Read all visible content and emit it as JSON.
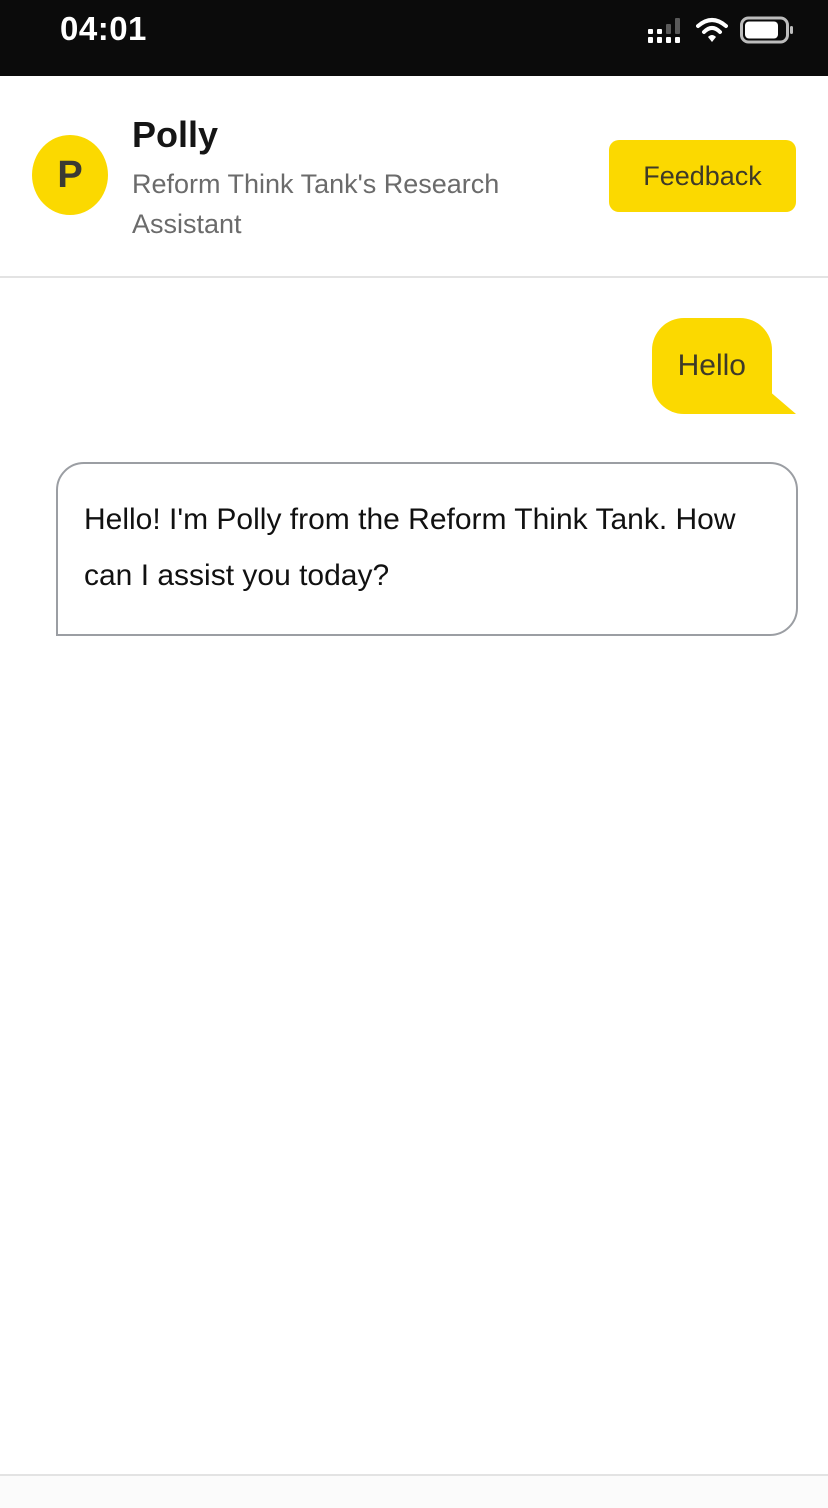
{
  "status_bar": {
    "time": "04:01",
    "icons": [
      "signal-icon",
      "wifi-icon",
      "battery-icon"
    ]
  },
  "header": {
    "avatar_letter": "P",
    "bot_name": "Polly",
    "bot_subtitle": "Reform Think Tank's Research Assistant",
    "feedback_label": "Feedback"
  },
  "messages": [
    {
      "sender": "user",
      "text": "Hello"
    },
    {
      "sender": "bot",
      "text": "Hello! I'm Polly from the Reform Think Tank. How can I assist you today?"
    }
  ],
  "colors": {
    "accent": "#fbd900",
    "status_bar": "#0b0b0b",
    "bubble_border": "#9b9ea3"
  }
}
